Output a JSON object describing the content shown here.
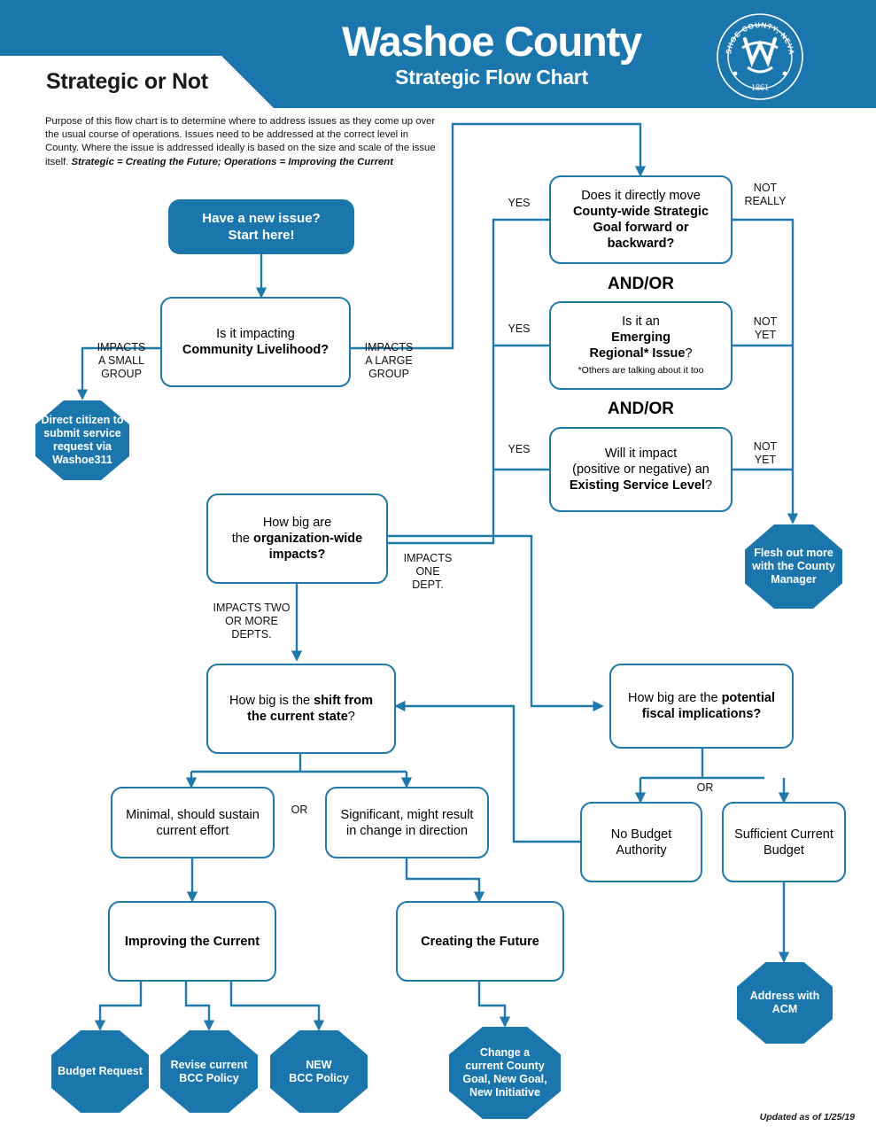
{
  "header": {
    "page_title": "Strategic or Not",
    "brand_title": "Washoe County",
    "brand_subtitle": "Strategic Flow Chart",
    "seal": {
      "outer_text": "WASHOE COUNTY, NEVADA",
      "year": "1861",
      "monogram": "W"
    },
    "accent_color": "#1b76ad",
    "line_color": "#2079ab"
  },
  "purpose": {
    "body": "Purpose of this flow chart is to determine where to address issues as they come up over the usual course of operations. Issues need to be addressed at the correct level in County. Where the issue is addressed ideally is based on the size and scale of the issue itself.",
    "tagline": "Strategic = Creating the Future; Operations = Improving the Current"
  },
  "footer": {
    "updated": "Updated as of 1/25/19"
  },
  "chart_data": {
    "type": "diagram",
    "title": "Washoe County Strategic Flow Chart",
    "nodes": [
      {
        "id": "start",
        "shape": "start-box",
        "text": "Have a new issue?\nStart here!"
      },
      {
        "id": "community",
        "shape": "process",
        "text": "Is it impacting\nCommunity Livelihood?"
      },
      {
        "id": "washoe311",
        "shape": "octagon",
        "text": "Direct citizen to submit service request via Washoe311"
      },
      {
        "id": "strategic_goal",
        "shape": "process",
        "text": "Does it directly move County-wide Strategic Goal forward or backward?"
      },
      {
        "id": "emerging_regional",
        "shape": "process",
        "text": "Is it an Emerging Regional* Issue?",
        "footnote": "*Others are talking about it too"
      },
      {
        "id": "service_level",
        "shape": "process",
        "text": "Will it impact (positive or negative) an Existing Service Level?"
      },
      {
        "id": "county_manager",
        "shape": "octagon",
        "text": "Flesh out more with the County Manager"
      },
      {
        "id": "org_wide",
        "shape": "process",
        "text": "How big are the organization-wide impacts?"
      },
      {
        "id": "shift_current",
        "shape": "process",
        "text": "How big is the shift from the current state?"
      },
      {
        "id": "fiscal",
        "shape": "process",
        "text": "How big are the potential fiscal implications?"
      },
      {
        "id": "minimal",
        "shape": "process",
        "text": "Minimal, should sustain current effort"
      },
      {
        "id": "significant",
        "shape": "process",
        "text": "Significant, might result in change in direction"
      },
      {
        "id": "no_budget",
        "shape": "process",
        "text": "No Budget Authority"
      },
      {
        "id": "sufficient_budget",
        "shape": "process",
        "text": "Sufficient Current Budget"
      },
      {
        "id": "improving",
        "shape": "process",
        "text": "Improving the Current"
      },
      {
        "id": "creating",
        "shape": "process",
        "text": "Creating the Future"
      },
      {
        "id": "budget_request",
        "shape": "octagon",
        "text": "Budget Request"
      },
      {
        "id": "revise_bcc",
        "shape": "octagon",
        "text": "Revise current BCC Policy"
      },
      {
        "id": "new_bcc",
        "shape": "octagon",
        "text": "NEW BCC Policy"
      },
      {
        "id": "change_goal",
        "shape": "octagon",
        "text": "Change a current County Goal, New Goal, New Initiative"
      },
      {
        "id": "address_acm",
        "shape": "octagon",
        "text": "Address with ACM"
      }
    ],
    "edges": [
      {
        "from": "start",
        "to": "community",
        "label": ""
      },
      {
        "from": "community",
        "to": "washoe311",
        "label": "IMPACTS A SMALL GROUP"
      },
      {
        "from": "community",
        "to": "strategic_goal",
        "label": "IMPACTS A LARGE GROUP"
      },
      {
        "from": "strategic_goal",
        "to": "org_wide",
        "label": "YES"
      },
      {
        "from": "strategic_goal",
        "to": "county_manager",
        "label": "NOT REALLY"
      },
      {
        "from": "emerging_regional",
        "to": "org_wide",
        "label": "YES"
      },
      {
        "from": "emerging_regional",
        "to": "county_manager",
        "label": "NOT YET"
      },
      {
        "from": "service_level",
        "to": "org_wide",
        "label": "YES"
      },
      {
        "from": "service_level",
        "to": "county_manager",
        "label": "NOT YET"
      },
      {
        "from": "org_wide",
        "to": "shift_current",
        "label": "IMPACTS TWO OR MORE DEPTS."
      },
      {
        "from": "org_wide",
        "to": "fiscal",
        "label": "IMPACTS ONE DEPT."
      },
      {
        "from": "shift_current",
        "to": "minimal",
        "label": ""
      },
      {
        "from": "shift_current",
        "to": "significant",
        "label": "OR"
      },
      {
        "from": "fiscal",
        "to": "no_budget",
        "label": ""
      },
      {
        "from": "fiscal",
        "to": "sufficient_budget",
        "label": "OR"
      },
      {
        "from": "no_budget",
        "to": "shift_current",
        "label": ""
      },
      {
        "from": "sufficient_budget",
        "to": "address_acm",
        "label": ""
      },
      {
        "from": "minimal",
        "to": "improving",
        "label": ""
      },
      {
        "from": "significant",
        "to": "creating",
        "label": ""
      },
      {
        "from": "improving",
        "to": "budget_request",
        "label": ""
      },
      {
        "from": "improving",
        "to": "revise_bcc",
        "label": ""
      },
      {
        "from": "improving",
        "to": "new_bcc",
        "label": ""
      },
      {
        "from": "creating",
        "to": "change_goal",
        "label": ""
      }
    ],
    "connectors": [
      "AND/OR",
      "AND/OR"
    ]
  },
  "nodes": {
    "start": {
      "line1": "Have a new issue?",
      "line2": "Start here!"
    },
    "community": {
      "line1": "Is it impacting",
      "line2": "Community Livelihood?"
    },
    "washoe311": {
      "text": "Direct citizen to submit service request via Washoe311"
    },
    "strategic_goal": {
      "line1": "Does it directly move",
      "line2": "County-wide Strategic",
      "line3": "Goal forward or",
      "line4": "backward?"
    },
    "emerging_regional": {
      "line1": "Is it an",
      "line2": "Emerging",
      "line3": "Regional* Issue",
      "line4": "?",
      "footnote": "*Others are talking about it too"
    },
    "service_level": {
      "line1": "Will it impact",
      "line2": "(positive or negative) an",
      "line3": "Existing Service Level",
      "line4": "?"
    },
    "county_manager": {
      "text": "Flesh out more with the County Manager"
    },
    "org_wide": {
      "line1": "How big are",
      "line2a": "the ",
      "line2b": "organization-wide",
      "line3": "impacts?"
    },
    "shift_current": {
      "line1a": "How big is the ",
      "line1b": "shift from",
      "line2a": "the current state",
      "line2b": "?"
    },
    "fiscal": {
      "line1a": "How big are the ",
      "line1b": "potential",
      "line2a": "fiscal implications?"
    },
    "minimal": {
      "line1": "Minimal, should sustain",
      "line2": "current effort"
    },
    "significant": {
      "line1": "Significant, might result",
      "line2": "in change in direction"
    },
    "no_budget": {
      "line1": "No Budget",
      "line2": "Authority"
    },
    "sufficient_budget": {
      "line1": "Sufficient Current",
      "line2": "Budget"
    },
    "improving": {
      "text": "Improving the Current"
    },
    "creating": {
      "text": "Creating the Future"
    },
    "budget_request": {
      "text": "Budget Request"
    },
    "revise_bcc": {
      "line1": "Revise current",
      "line2": "BCC Policy"
    },
    "new_bcc": {
      "line1": "NEW",
      "line2": "BCC Policy"
    },
    "change_goal": {
      "line1": "Change a",
      "line2": "current County",
      "line3": "Goal, New Goal,",
      "line4": "New Initiative"
    },
    "address_acm": {
      "line1": "Address with",
      "line2": "ACM"
    }
  },
  "labels": {
    "impacts_small": "IMPACTS\nA SMALL\nGROUP",
    "impacts_large": "IMPACTS\nA LARGE\nGROUP",
    "yes1": "YES",
    "yes2": "YES",
    "yes3": "YES",
    "not_really": "NOT\nREALLY",
    "not_yet1": "NOT\nYET",
    "not_yet2": "NOT\nYET",
    "andor1": "AND/OR",
    "andor2": "AND/OR",
    "impacts_one": "IMPACTS\nONE\nDEPT.",
    "impacts_two": "IMPACTS TWO\nOR MORE\nDEPTS.",
    "or_left": "OR",
    "or_right": "OR"
  }
}
